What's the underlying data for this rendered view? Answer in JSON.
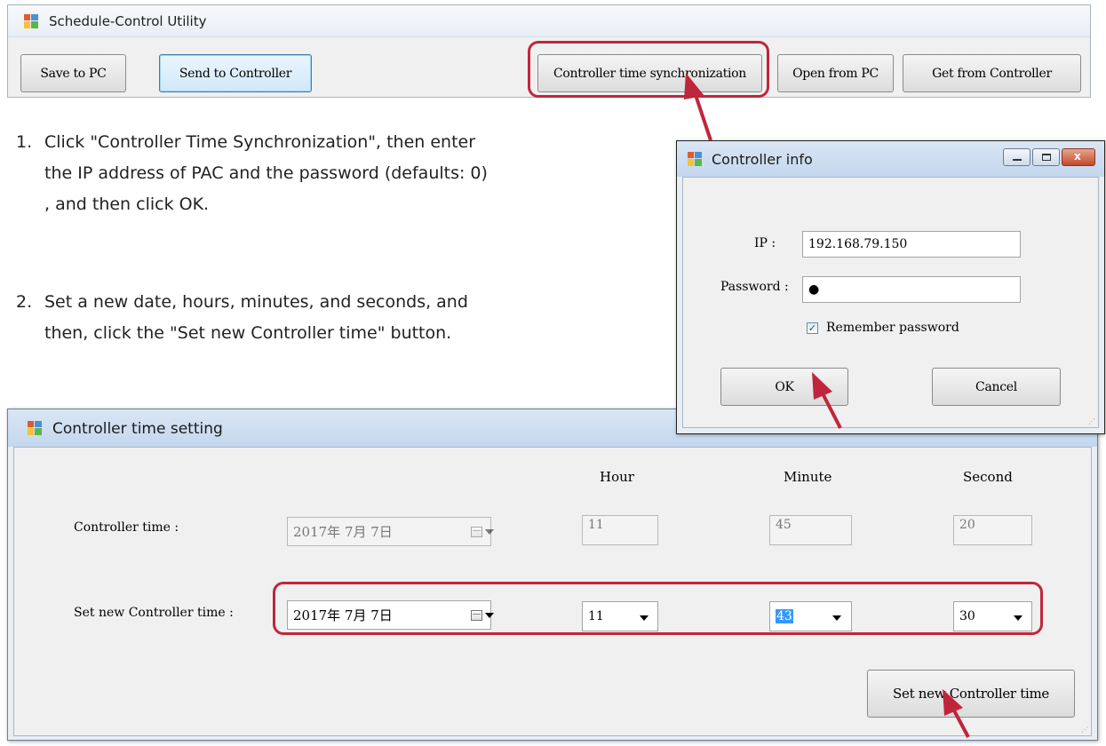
{
  "top_window": {
    "title": "Schedule-Control Utility",
    "buttons": {
      "save_to_pc": "Save to PC",
      "send_to_controller": "Send to Controller",
      "time_sync": "Controller time synchronization",
      "open_from_pc": "Open from PC",
      "get_from_controller": "Get from Controller"
    }
  },
  "instructions": {
    "step1_num": "1.",
    "step1_line1": "Click \"Controller Time Synchronization\", then enter",
    "step1_line2": "the IP address of PAC and the password (defaults: 0)",
    "step1_line3": ", and then click OK.",
    "step2_num": "2.",
    "step2_line1": "Set a new date, hours, minutes, and seconds, and",
    "step2_line2": "then, click the \"Set new Controller time\" button."
  },
  "controller_info": {
    "title": "Controller info",
    "ip_label": "IP :",
    "ip_value": "192.168.79.150",
    "password_label": "Password :",
    "password_value": "●",
    "remember_label": "Remember password",
    "remember_checked": "✓",
    "ok_label": "OK",
    "cancel_label": "Cancel"
  },
  "time_setting": {
    "title": "Controller time setting",
    "col_hour": "Hour",
    "col_minute": "Minute",
    "col_second": "Second",
    "controller_time_label": "Controller time :",
    "current_date": "2017年  7月  7日",
    "current_hour": "11",
    "current_minute": "45",
    "current_second": "20",
    "new_time_label": "Set new Controller time :",
    "new_date": "2017年  7月  7日",
    "new_hour": "11",
    "new_minute": "43",
    "new_second": "30",
    "set_button": "Set new Controller time"
  },
  "colors": {
    "highlight": "#c0263b",
    "titlebar": "#c4d7ee",
    "focus_border": "#3c7fb1"
  }
}
